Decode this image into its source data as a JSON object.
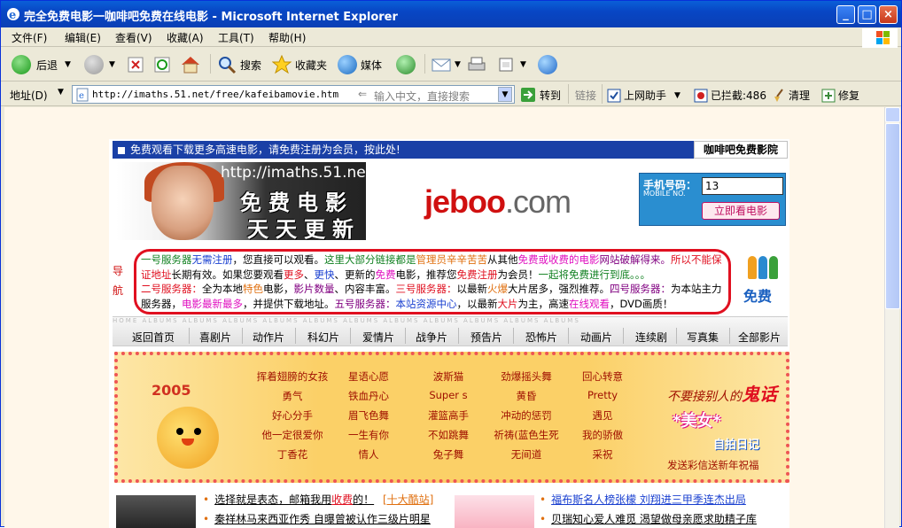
{
  "window": {
    "title": "完全免费电影一咖啡吧免费在线电影 - Microsoft Internet Explorer"
  },
  "menu": [
    "文件(F)",
    "编辑(E)",
    "查看(V)",
    "收藏(A)",
    "工具(T)",
    "帮助(H)"
  ],
  "toolbar": {
    "back": "后退",
    "search": "搜索",
    "favorites": "收藏夹",
    "media": "媒体"
  },
  "address": {
    "label": "地址(D)",
    "url": "http://imaths.51.net/free/kafeibamovie.htm",
    "hint": "输入中文，直接搜索",
    "go": "转到",
    "links": "链接",
    "assistant": "上网助手",
    "blocked": "已拦截:486",
    "clean": "清理",
    "repair": "修复"
  },
  "page": {
    "notice": "免费观看下载更多高速电影，请免费注册为会员，按此处!",
    "brand": "咖啡吧免费影院",
    "banner_url": "http://imaths.51.net",
    "banner_line1": "免费电影",
    "banner_line2": "天天更新",
    "logo": "jeboo",
    "logo_suffix": ".com",
    "phone_label": "手机号码：",
    "phone_sub": "MOBILE NO.",
    "phone_value": "13",
    "phone_button": "立即看电影",
    "nav_label": "导航",
    "free_badge": "免费",
    "info": {
      "s1": "一号服务器",
      "s2": "无需注册",
      "s3": "，您直接可以观看。",
      "s4": "这里大部分链接都是",
      "s5": "管理员辛辛苦苦",
      "s6": "从其他",
      "s7": "免费或收费的电影",
      "s8": "网站破解得来。",
      "s9": "所以不能保证地址",
      "s10": "长期有效。如果您要观看",
      "s11": "更多",
      "s12": "、",
      "s13": "更快",
      "s14": "、更新的",
      "s15": "免费",
      "s16": "电影，推荐您",
      "s17": "免费注册",
      "s18": "为会员！",
      "s19": "一起将免费进行到底。。。",
      "s20": "二号服务器：",
      "s21": "全为本地",
      "s22": "特色",
      "s23": "电影，",
      "s24": "影片数量",
      "s25": "、内容丰富。",
      "s26": "三号服务器：",
      "s27": "以最新",
      "s28": "火爆",
      "s29": "大片居多，强烈推荐。",
      "s30": "四号服务器：",
      "s31": "为本站主力服务器，",
      "s32": "电影最新最多",
      "s33": "，并提供下载地址。",
      "s34": "五号服务器：",
      "s35": "本站资源中心",
      "s36": "，以最新",
      "s37": "大片",
      "s38": "为主，高速",
      "s39": "在线观看",
      "s40": "，DVD画质！"
    },
    "categories": [
      "返回首页",
      "喜剧片",
      "动作片",
      "科幻片",
      "爱情片",
      "战争片",
      "预告片",
      "恐怖片",
      "动画片",
      "连续剧",
      "写真集",
      "全部影片"
    ],
    "cat_deco": "HOME ALBUMS ALBUMS ALBUMS ALBUMS ALBUMS ALBUMS ALBUMS ALBUMS ALBUMS ALBUMS ALBUMS",
    "promo": {
      "year": "2005",
      "grid": [
        [
          "挥着翅膀的女孩",
          "星语心愿",
          "波斯猫",
          "劲爆摇头舞",
          "回心转意"
        ],
        [
          "勇气",
          "铁血丹心",
          "Super s",
          "黄昏",
          "Pretty"
        ],
        [
          "好心分手",
          "眉飞色舞",
          "灌篮高手",
          "冲动的惩罚",
          "遇见"
        ],
        [
          "他一定很爱你",
          "一生有你",
          "不如跳舞",
          "祈祷(蓝色生死",
          "我的骄傲"
        ],
        [
          "丁香花",
          "情人",
          "兔子舞",
          "无间道",
          "采祝"
        ]
      ],
      "slogan_a": "不要接别人的",
      "slogan_b": "鬼话",
      "beauty": "*美女*",
      "selfie": "自拍日记",
      "sms": "发送彩信送新年祝福"
    },
    "news": {
      "n1a": "选择就是表态，邮箱我用",
      "n1b": "收费",
      "n1c": "的！",
      "n1d": "[十大酷站]",
      "n2": "秦祥林马来西亚作秀 自曝曾被认作三级片明星",
      "n3": "福布斯名人榜张檬 刘翔进三甲季连杰出局",
      "n4": "贝瑞知心爱人难觅 渴望做母亲愿求助精子库"
    }
  }
}
